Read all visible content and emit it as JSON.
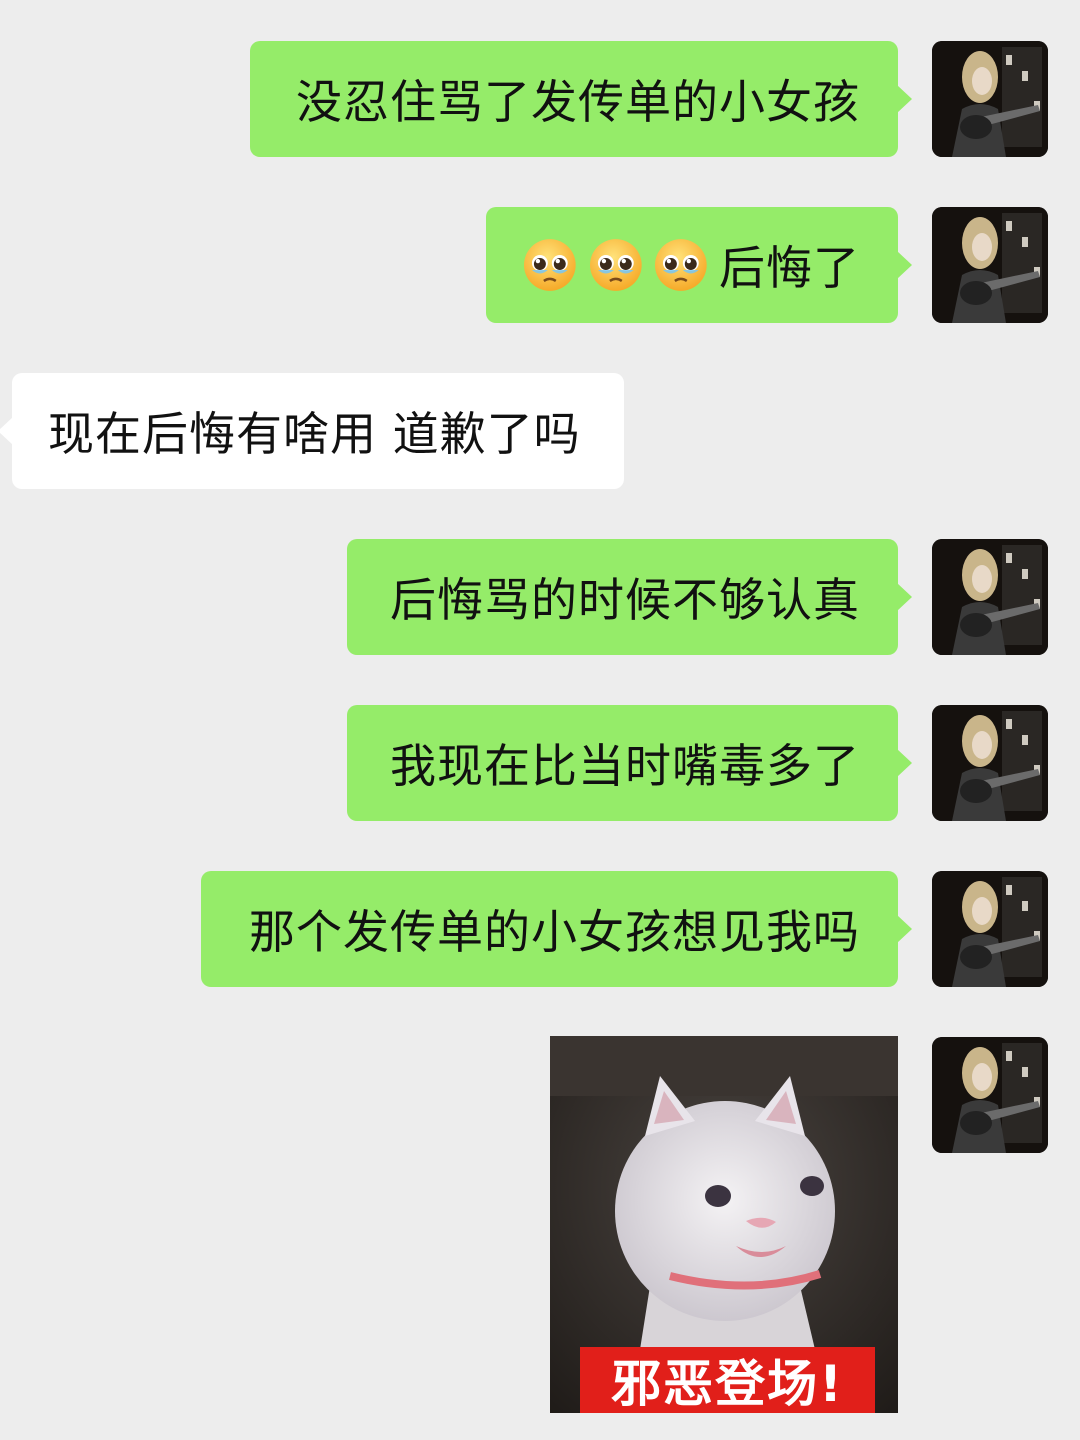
{
  "messages": [
    {
      "side": "out",
      "text": "没忍住骂了发传单的小女孩"
    },
    {
      "side": "out",
      "emojis": [
        "pleading-face",
        "pleading-face",
        "pleading-face"
      ],
      "text": "后悔了"
    },
    {
      "side": "in",
      "text": "现在后悔有啥用 道歉了吗"
    },
    {
      "side": "out",
      "text": "后悔骂的时候不够认真"
    },
    {
      "side": "out",
      "text": "我现在比当时嘴毒多了"
    },
    {
      "side": "out",
      "text": "那个发传单的小女孩想见我吗"
    },
    {
      "side": "out",
      "type": "sticker",
      "sticker_subject": "white-kitten",
      "caption": "邪恶登场!"
    }
  ],
  "colors": {
    "background": "#ededed",
    "outgoing_bubble": "#95ec69",
    "incoming_bubble": "#ffffff",
    "caption_red": "#e11f1a"
  },
  "icons": {
    "avatar": "user-avatar-guitarist",
    "emoji": "pleading-face-emoji"
  }
}
